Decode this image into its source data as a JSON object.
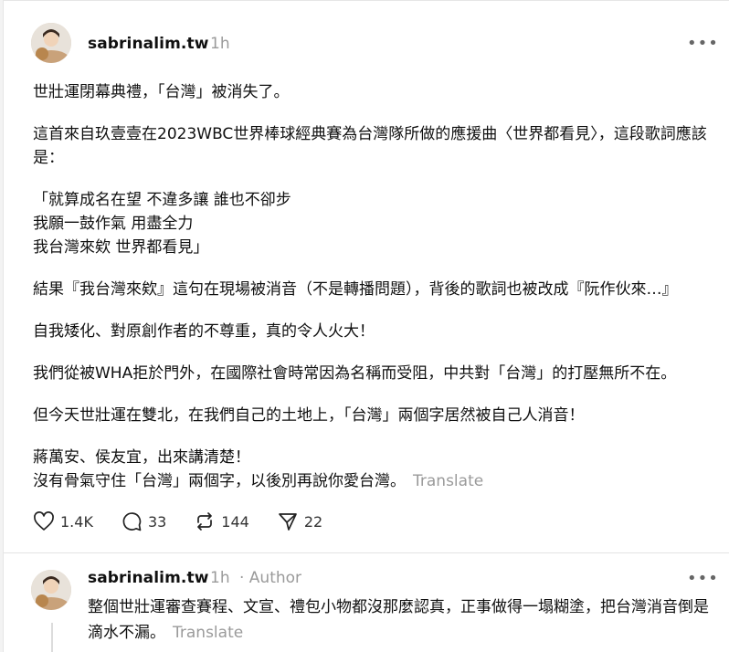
{
  "post": {
    "username": "sabrinalim.tw",
    "time": "1h",
    "paragraphs": [
      "世壯運閉幕典禮，「台灣」被消失了。",
      "這首來自玖壹壹在2023WBC世界棒球經典賽為台灣隊所做的應援曲〈世界都看見〉，這段歌詞應該是：",
      "「就算成名在望 不違多讓 誰也不卻步\n我願一鼓作氣 用盡全力\n我台灣來欸 世界都看見」",
      "結果『我台灣來欸』這句在現場被消音（不是轉播問題），背後的歌詞也被改成『阮作伙來…』",
      "自我矮化、對原創作者的不尊重，真的令人火大！",
      "我們從被WHA拒於門外，在國際社會時常因為名稱而受阻，中共對「台灣」的打壓無所不在。",
      "但今天世壯運在雙北，在我們自己的土地上，「台灣」兩個字居然被自己人消音！"
    ],
    "last_paragraph": "蔣萬安、侯友宜，出來講清楚！\n沒有骨氣守住「台灣」兩個字，以後別再說你愛台灣。",
    "translate": "Translate",
    "likes": "1.4K",
    "comments": "33",
    "reposts": "144",
    "shares": "22"
  },
  "reply": {
    "username": "sabrinalim.tw",
    "time": "1h",
    "author_badge": "· Author",
    "text": "整個世壯運審查賽程、文宣、禮包小物都沒那麼認真，正事做得一塌糊塗，把台灣消音倒是滴水不漏。",
    "translate": "Translate"
  },
  "icons": {
    "like": "heart-icon",
    "comment": "comment-icon",
    "repost": "repost-icon",
    "share": "send-icon",
    "more": "more-icon"
  }
}
